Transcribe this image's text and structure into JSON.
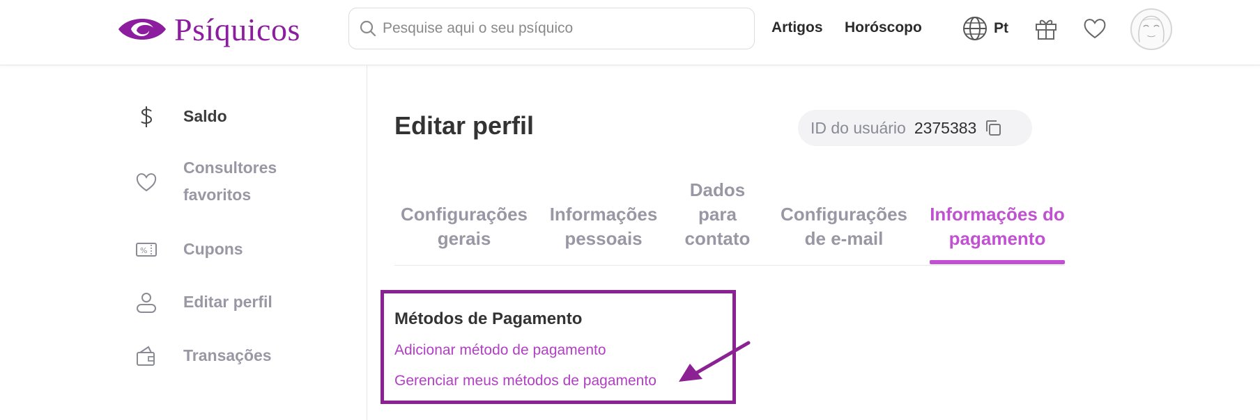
{
  "header": {
    "logo_text": "Psíquicos",
    "search_placeholder": "Pesquise aqui o seu psíquico",
    "nav": [
      "Artigos",
      "Horóscopo"
    ],
    "language": "Pt",
    "icons": [
      "globe-icon",
      "gift-icon",
      "heart-icon",
      "avatar"
    ]
  },
  "sidebar": {
    "items": [
      {
        "label": "Saldo",
        "icon": "dollar-icon",
        "active": true
      },
      {
        "label": "Consultores favoritos",
        "icon": "heart-icon",
        "active": false
      },
      {
        "label": "Cupons",
        "icon": "coupon-icon",
        "active": false
      },
      {
        "label": "Editar perfil",
        "icon": "user-icon",
        "active": false
      },
      {
        "label": "Transações",
        "icon": "wallet-icon",
        "active": false
      }
    ]
  },
  "main": {
    "title": "Editar perfil",
    "user_id_label": "ID do usuário",
    "user_id_value": "2375383",
    "tabs": [
      {
        "label": "Configurações gerais",
        "active": false
      },
      {
        "label": "Informações pessoais",
        "active": false
      },
      {
        "label": "Dados para contato",
        "active": false
      },
      {
        "label": "Configurações de e-mail",
        "active": false
      },
      {
        "label": "Informações do pagamento",
        "active": true
      }
    ],
    "payment": {
      "title": "Métodos de Pagamento",
      "links": [
        "Adicionar método de pagamento",
        "Gerenciar meus métodos de pagamento"
      ]
    }
  },
  "colors": {
    "brand": "#8b1d9e",
    "accent": "#c052d1",
    "link": "#b13fc4",
    "annotation": "#8b2193"
  }
}
